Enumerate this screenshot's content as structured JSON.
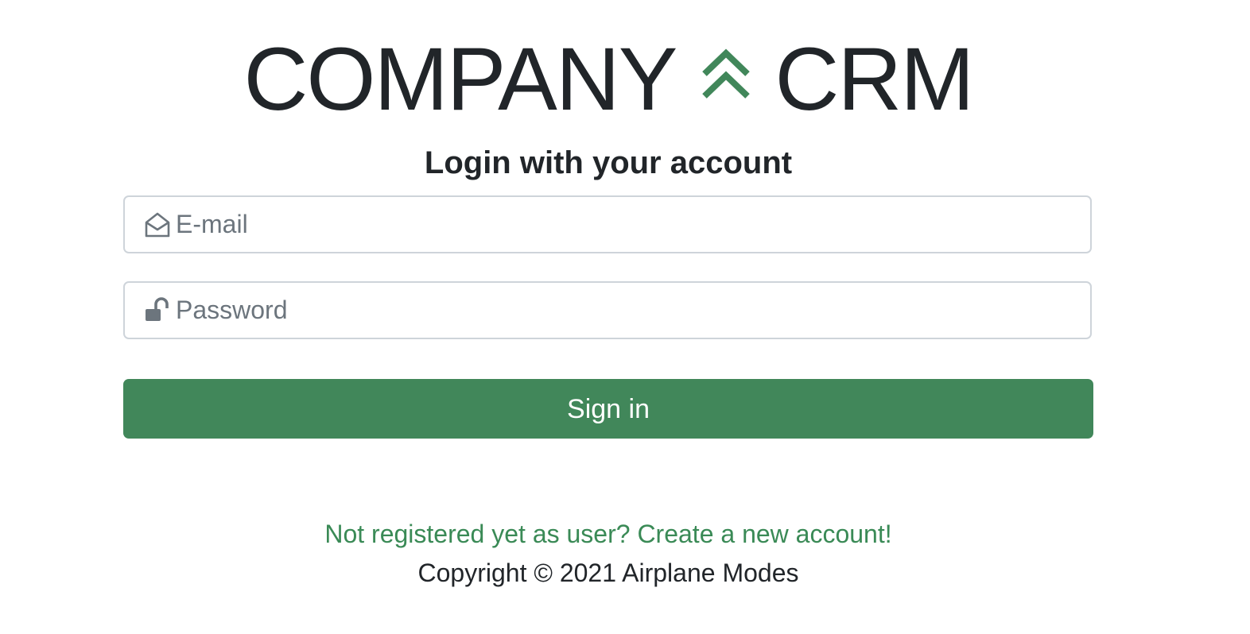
{
  "logo": {
    "left_text": "COMPANY",
    "right_text": "CRM",
    "mark_icon": "double-chevron-up-icon",
    "mark_color": "#41875a"
  },
  "login": {
    "title": "Login with your account",
    "email": {
      "placeholder": "E-mail",
      "value": "",
      "icon": "envelope-open-icon"
    },
    "password": {
      "placeholder": "Password",
      "value": "",
      "icon": "unlock-icon"
    },
    "submit_label": "Sign in"
  },
  "footer": {
    "register_link": "Not registered yet as user? Create a new account!",
    "copyright": "Copyright © 2021 Airplane Modes"
  },
  "colors": {
    "primary": "#41875a",
    "link": "#3a8a56",
    "text": "#212529",
    "placeholder": "#6c757d",
    "border": "#ced4da"
  }
}
